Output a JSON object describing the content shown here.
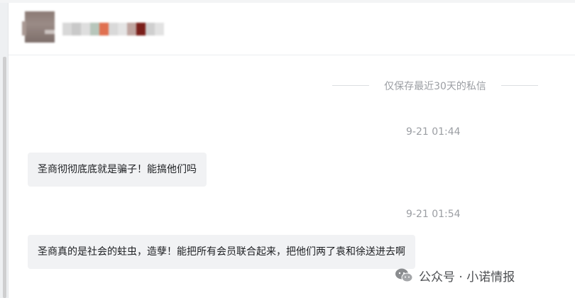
{
  "conversation": {
    "contact_name": "",
    "notice": "仅保存最近30天的私信",
    "messages": [
      {
        "time": "9-21 01:44",
        "text": "圣商彻彻底底就是骗子！能搞他们吗"
      },
      {
        "time": "9-21 01:54",
        "text": "圣商真的是社会的蛀虫，造孽！能把所有会员联合起来，把他们两了袁和徐送进去啊"
      }
    ]
  },
  "watermark": {
    "text": "公众号 · 小诺情报",
    "icon": "wechat-icon"
  },
  "colors": {
    "background": "#ffffff",
    "bubble": "#f1f2f4",
    "muted_text": "#9b9ea3",
    "message_text": "#1d1f22"
  },
  "contact_name_pixels": [
    "#d8d8d8",
    "#c9c9c9",
    "#dedede",
    "#b7c6bb",
    "#e07050",
    "#d9d9d9",
    "#e4e4e4",
    "#bfa5a0",
    "#7a1f1a",
    "#cfcfcf",
    "#e2e2e2"
  ]
}
